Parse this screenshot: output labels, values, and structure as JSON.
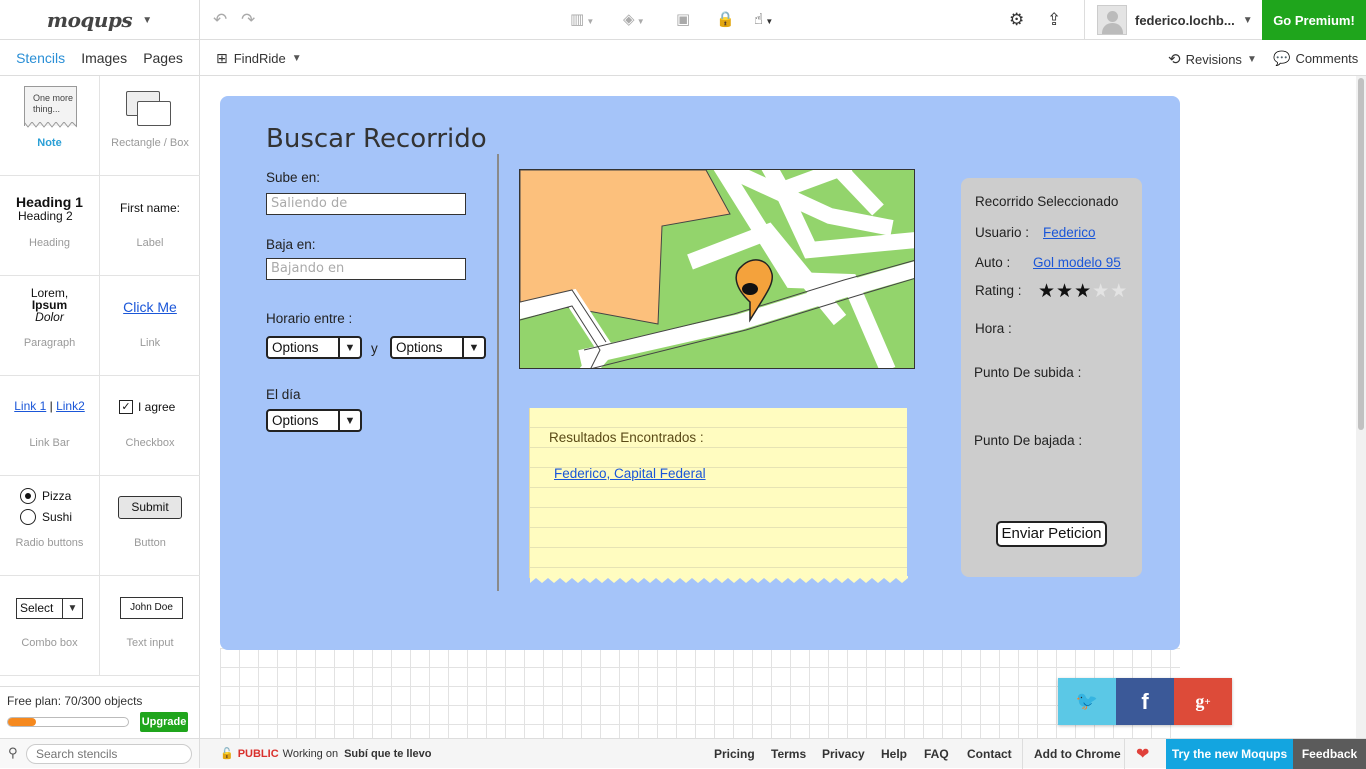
{
  "app": {
    "logo": "moqups",
    "premium_label": "Go Premium!",
    "user_name": "federico.lochb..."
  },
  "subbar": {
    "tabs": [
      "Stencils",
      "Images",
      "Pages"
    ],
    "page_name": "FindRide",
    "revisions": "Revisions",
    "comments": "Comments"
  },
  "stencils": [
    {
      "label": "Note",
      "preview": "One more thing..."
    },
    {
      "label": "Rectangle / Box"
    },
    {
      "label": "Heading",
      "preview1": "Heading 1",
      "preview2": "Heading 2"
    },
    {
      "label": "Label",
      "preview": "First name:"
    },
    {
      "label": "Paragraph",
      "preview1": "Lorem,",
      "preview2": "Ipsum",
      "preview3": "Dolor"
    },
    {
      "label": "Link",
      "preview": "Click Me"
    },
    {
      "label": "Link Bar",
      "preview1": "Link 1",
      "preview2": "Link2"
    },
    {
      "label": "Checkbox",
      "preview": "I agree"
    },
    {
      "label": "Radio buttons",
      "preview1": "Pizza",
      "preview2": "Sushi"
    },
    {
      "label": "Button",
      "preview": "Submit"
    },
    {
      "label": "Combo box",
      "preview": "Select"
    },
    {
      "label": "Text input",
      "preview": "John Doe"
    }
  ],
  "plan": {
    "text": "Free plan: 70/300 objects",
    "used": 70,
    "limit": 300,
    "upgrade_label": "Upgrade"
  },
  "search": {
    "placeholder": "Search stencils"
  },
  "mockup": {
    "title": "Buscar Recorrido",
    "sube_label": "Sube en:",
    "sube_placeholder": "Saliendo de",
    "baja_label": "Baja en:",
    "baja_placeholder": "Bajando en",
    "horario_label": "Horario entre :",
    "combo_value": "Options",
    "y_label": "y",
    "dia_label": "El día",
    "results_title": "Resultados Encontrados :",
    "results_link": "Federico, Capital Federal",
    "panel": {
      "title": "Recorrido Seleccionado",
      "usuario_label": "Usuario :",
      "usuario_value": "Federico",
      "auto_label": "Auto :",
      "auto_value": "Gol modelo 95",
      "rating_label": "Rating :",
      "rating": 3,
      "rating_max": 5,
      "hora_label": "Hora :",
      "subida_label": "Punto De subida :",
      "bajada_label": "Punto De bajada :",
      "button_label": "Enviar Peticion"
    }
  },
  "footer": {
    "public_label": "PUBLIC",
    "working_on": "Working on",
    "project_name": "Subí que te llevo",
    "links": [
      "Pricing",
      "Terms",
      "Privacy",
      "Help",
      "FAQ",
      "Contact",
      "Add to Chrome"
    ],
    "try_new": "Try the new Moqups",
    "feedback": "Feedback"
  },
  "colors": {
    "accent": "#2a8fd6",
    "premium": "#1fa51c",
    "board": "#a5c4f9",
    "twitter": "#5bc8e6",
    "facebook": "#3b5998",
    "gplus": "#dd4b39"
  }
}
